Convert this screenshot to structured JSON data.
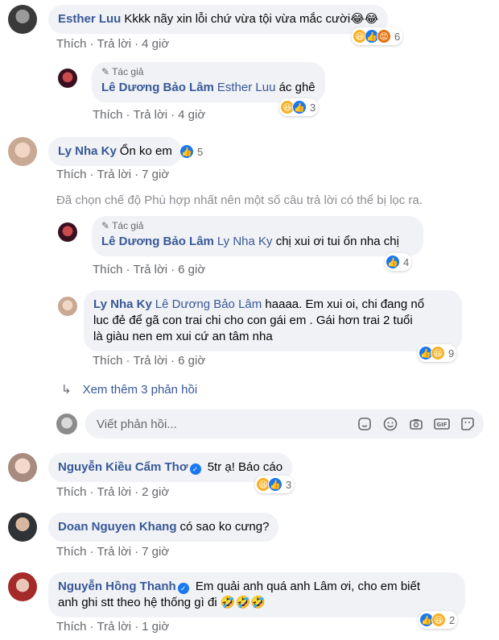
{
  "comments": [
    {
      "name": "Esther Luu",
      "text": "Kkkk nãy xin lỗi chứ vừa tội vừa mắc cười😂😂",
      "actions": {
        "like": "Thích",
        "reply": "Trả lời",
        "time": "4 giờ"
      },
      "reactions": {
        "count": "6"
      }
    },
    {
      "author_tag": "Tác giả",
      "name": "Lê Dương Bảo Lâm",
      "mention": "Esther Luu",
      "text": "ác ghê",
      "actions": {
        "like": "Thích",
        "reply": "Trả lời",
        "time": "4 giờ"
      },
      "reactions": {
        "count": "3"
      }
    },
    {
      "name": "Ly Nha Ky",
      "text": "Ổn ko em",
      "actions": {
        "like": "Thích",
        "reply": "Trả lời",
        "time": "7 giờ"
      },
      "reactions": {
        "count": "5"
      }
    },
    {
      "author_tag": "Tác giả",
      "name": "Lê Dương Bảo Lâm",
      "mention": "Ly Nha Ky",
      "text": "chị xui ơi tui ổn nha chị",
      "actions": {
        "like": "Thích",
        "reply": "Trả lời",
        "time": "6 giờ"
      },
      "reactions": {
        "count": "4"
      }
    },
    {
      "name": "Ly Nha Ky",
      "mention": "Lê Dương Bảo Lâm",
      "text_line1": "haaaa. Em xui oi, chi đang nổ",
      "text_line2": "luc đẻ để gã con trai chi cho con gái em . Gái hơn trai 2 tuổi",
      "text_line3": "là giàu nen em xui cứ an tâm nha",
      "actions": {
        "like": "Thích",
        "reply": "Trả lời",
        "time": "6 giờ"
      },
      "reactions": {
        "count": "9"
      }
    },
    {
      "name": "Nguyễn Kiều Cẩm Thơ",
      "text": "5tr ạ! Báo cáo",
      "actions": {
        "like": "Thích",
        "reply": "Trả lời",
        "time": "2 giờ"
      },
      "reactions": {
        "count": "3"
      }
    },
    {
      "name": "Doan Nguyen Khang",
      "text": "có sao ko cưng?",
      "actions": {
        "like": "Thích",
        "reply": "Trả lời",
        "time": "7 giờ"
      }
    },
    {
      "name": "Nguyễn Hồng Thanh",
      "text_line1": "Em quải anh quá anh Lâm ơi, cho em biết",
      "text_line2": "anh ghi stt theo hệ thống gì đi 🤣🤣🤣",
      "actions": {
        "like": "Thích",
        "reply": "Trả lời",
        "time": "1 giờ"
      },
      "reactions": {
        "count": "2"
      }
    }
  ],
  "notice": "Đã chọn chế độ Phù hợp nhất nên một số câu trả lời có thể bị lọc ra.",
  "more_replies": "Xem thêm 3 phản hồi",
  "reply_placeholder": "Viết phản hồi...",
  "colors": {
    "link": "#385898",
    "bubble": "#f0f2f5",
    "muted": "#65676b",
    "like": "#1877f2",
    "haha": "#f7b125",
    "angry": "#e9710f"
  }
}
